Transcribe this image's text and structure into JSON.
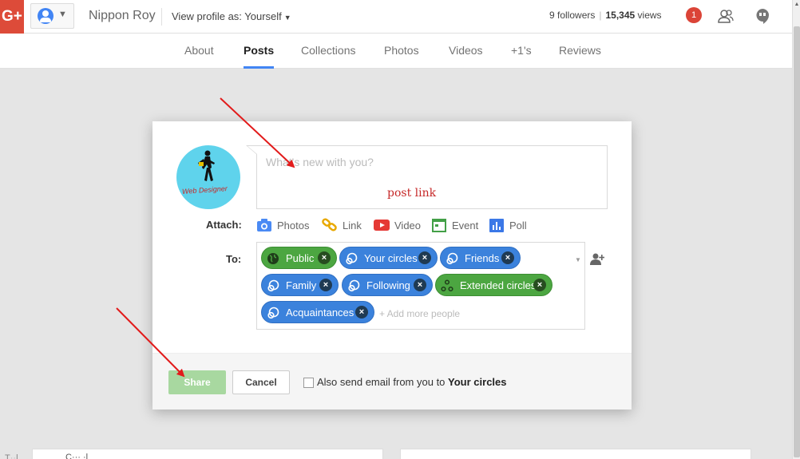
{
  "topbar": {
    "logo": "G+",
    "profile_name": "Nippon Roy",
    "view_profile_as": "View profile as: Yourself",
    "followers": "9 followers",
    "views_count": "15,345",
    "views_label": "views",
    "notification_count": "1"
  },
  "tabs": [
    "About",
    "Posts",
    "Collections",
    "Photos",
    "Videos",
    "+1's",
    "Reviews"
  ],
  "active_tab": "Posts",
  "composer": {
    "avatar_text": "Web Designer",
    "placeholder": "What's new with you?",
    "annotation": "post link",
    "attach_label": "Attach:",
    "attach_items": [
      "Photos",
      "Link",
      "Video",
      "Event",
      "Poll"
    ],
    "to_label": "To:",
    "recipients": [
      {
        "label": "Public",
        "color": "green",
        "icon": "globe-icon"
      },
      {
        "label": "Your circles",
        "color": "blue",
        "icon": "circles-icon"
      },
      {
        "label": "Friends",
        "color": "blue",
        "icon": "circles-icon"
      },
      {
        "label": "Family",
        "color": "blue",
        "icon": "circles-icon"
      },
      {
        "label": "Following",
        "color": "blue",
        "icon": "circles-icon"
      },
      {
        "label": "Extended circles",
        "color": "green",
        "icon": "extended-circles-icon"
      },
      {
        "label": "Acquaintances",
        "color": "blue",
        "icon": "circles-icon"
      }
    ],
    "add_more_placeholder": "+ Add more people",
    "share_label": "Share",
    "cancel_label": "Cancel",
    "email_prefix": "Also send email from you to ",
    "email_target": "Your circles"
  },
  "colors": {
    "brand_red": "#dd4b39",
    "chip_green": "#4ca641",
    "chip_blue": "#3b82dc",
    "active_tab": "#4285f4",
    "annotation_red": "#c62828"
  }
}
